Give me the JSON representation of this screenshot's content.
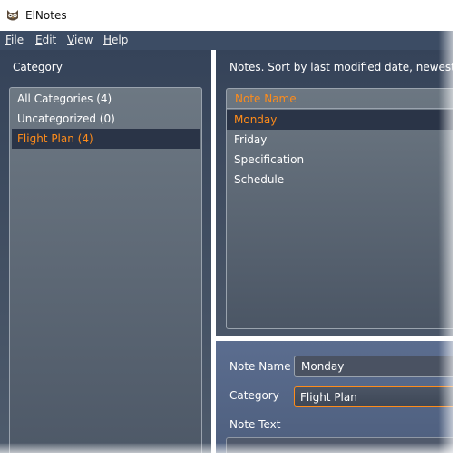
{
  "window": {
    "title": "ElNotes",
    "icon": "owl-icon"
  },
  "menu": {
    "items": [
      {
        "underlined": "F",
        "rest": "ile"
      },
      {
        "underlined": "E",
        "rest": "dit"
      },
      {
        "underlined": "V",
        "rest": "iew"
      },
      {
        "underlined": "H",
        "rest": "elp"
      }
    ]
  },
  "categories": {
    "label": "Category",
    "items": [
      {
        "label": "All Categories (4)",
        "selected": false
      },
      {
        "label": "Uncategorized (0)",
        "selected": false
      },
      {
        "label": "Flight Plan (4)",
        "selected": true
      }
    ]
  },
  "notes": {
    "caption": "Notes. Sort by last modified date, newest first",
    "column_header": "Note Name",
    "rows": [
      {
        "name": "Monday",
        "selected": true
      },
      {
        "name": "Friday",
        "selected": false
      },
      {
        "name": "Specification",
        "selected": false
      },
      {
        "name": "Schedule",
        "selected": false
      }
    ]
  },
  "editor": {
    "note_name_label": "Note Name",
    "note_name_value": "Monday",
    "category_label": "Category",
    "category_value": "Flight Plan",
    "note_text_label": "Note Text"
  },
  "colors": {
    "accent": "#ff8c1a",
    "panel_dark": "#354359",
    "selection": "#2a3447",
    "menubar": "#3c4c64"
  }
}
